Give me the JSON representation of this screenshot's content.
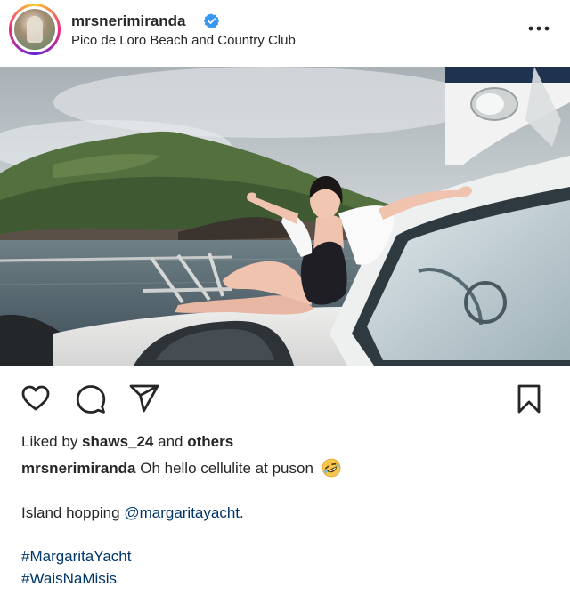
{
  "post": {
    "username": "mrsnerimiranda",
    "verified": true,
    "location": "Pico de Loro Beach and Country Club",
    "more_icon": "more-horizontal-icon"
  },
  "photo": {
    "alt": "Woman in black swimsuit and white shirt sitting on the bow of a yacht with arms outstretched, green island and sea behind"
  },
  "actions": {
    "like_icon": "heart-icon",
    "comment_icon": "comment-icon",
    "share_icon": "send-icon",
    "save_icon": "bookmark-icon"
  },
  "likes": {
    "prefix": "Liked by ",
    "user": "shaws_24",
    "middle": " and ",
    "others": "others"
  },
  "caption": {
    "username": "mrsnerimiranda",
    "text": " Oh hello cellulite at puson",
    "line2_prefix": "Island hopping ",
    "line2_mention": "@margaritayacht",
    "line2_suffix": ".",
    "hashtags": [
      "#MargaritaYacht",
      "#WaisNaMisis"
    ]
  },
  "colors": {
    "link": "#00376b",
    "text": "#262626",
    "verified": "#3897f0"
  }
}
